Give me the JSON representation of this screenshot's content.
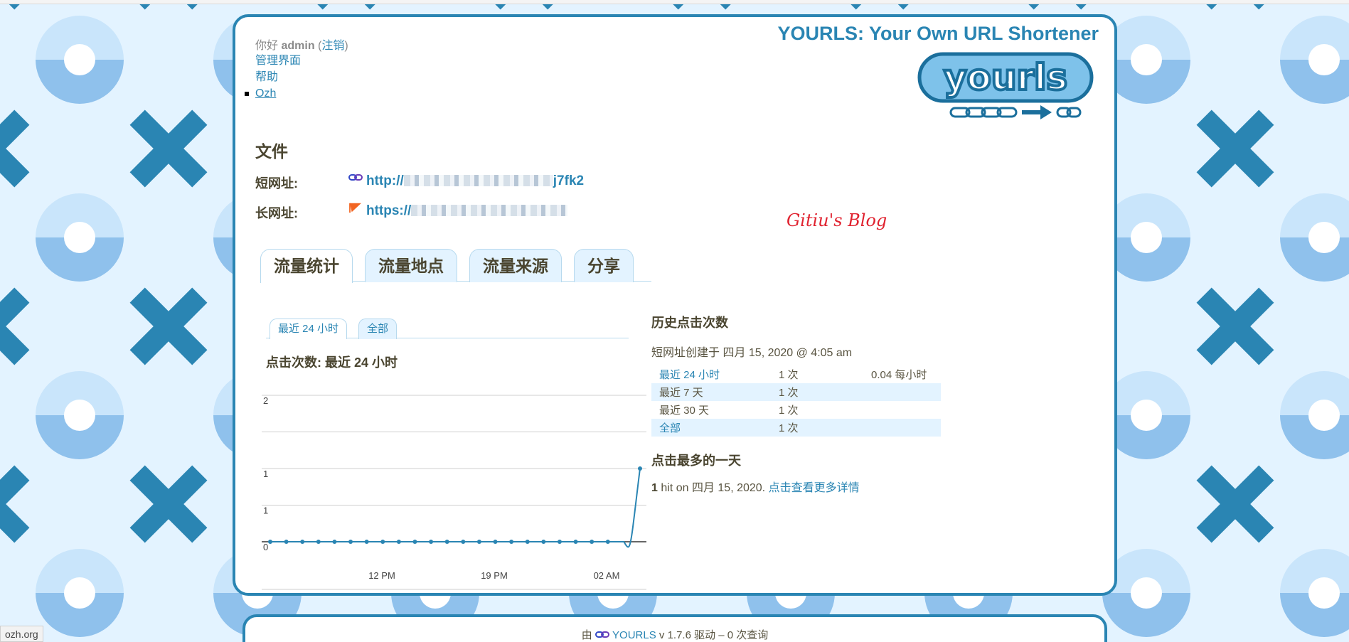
{
  "header": {
    "greeting": "你好",
    "username": "admin",
    "logout": "注销",
    "nav": [
      "管理界面",
      "帮助",
      "Ozh"
    ],
    "site_title": "YOURLS: Your Own URL Shortener",
    "logo_text": "yourls"
  },
  "info": {
    "section_title": "文件",
    "short_label": "短网址:",
    "short_url_prefix": "http://",
    "short_url_suffix": "j7fk2",
    "long_label": "长网址:",
    "long_url_prefix": "https://",
    "watermark": "Gitiu's Blog"
  },
  "tabs": [
    "流量统计",
    "流量地点",
    "流量来源",
    "分享"
  ],
  "subtabs": [
    "最近 24 小时",
    "全部"
  ],
  "chart_heading": "点击次数:  最近 24 小时",
  "chart_data": {
    "type": "line",
    "x_ticks": [
      "12 PM",
      "19 PM",
      "02 AM"
    ],
    "y_ticks": [
      "0",
      "1",
      "1",
      "2"
    ],
    "ylim": [
      0,
      2
    ],
    "series": [
      {
        "values": [
          0,
          0,
          0,
          0,
          0,
          0,
          0,
          0,
          0,
          0,
          0,
          0,
          0,
          0,
          0,
          0,
          0,
          0,
          0,
          0,
          0,
          0,
          0,
          1
        ]
      }
    ],
    "color": "#2a85b3"
  },
  "history": {
    "title": "历史点击次数",
    "created": "短网址创建于 四月 15, 2020 @ 4:05 am",
    "rows": [
      {
        "period": "最近 24 小时",
        "count": "1 次",
        "rate": "0.04 每小时",
        "link": true
      },
      {
        "period": "最近 7 天",
        "count": "1 次",
        "rate": "",
        "link": false
      },
      {
        "period": "最近 30 天",
        "count": "1 次",
        "rate": "",
        "link": false
      },
      {
        "period": "全部",
        "count": "1 次",
        "rate": "",
        "link": true
      }
    ]
  },
  "best": {
    "title": "点击最多的一天",
    "count": "1",
    "text": "hit on 四月 15, 2020.",
    "link": "点击查看更多详情"
  },
  "footer": {
    "prefix": "由",
    "brand": "YOURLS",
    "suffix": "v 1.7.6 驱动 – 0 次查询"
  },
  "status_bar": "ozh.org"
}
